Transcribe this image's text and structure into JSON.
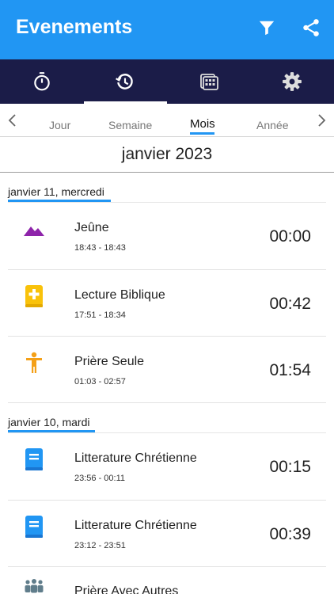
{
  "header": {
    "title": "Evenements",
    "background": "#2196f3",
    "actions": [
      {
        "icon": "filter-icon"
      },
      {
        "icon": "share-icon"
      }
    ]
  },
  "nav": {
    "background": "#1b1c48",
    "tabs": [
      {
        "icon": "stopwatch-icon",
        "active": false
      },
      {
        "icon": "history-icon",
        "active": true
      },
      {
        "icon": "calendar-grid-icon",
        "active": false
      },
      {
        "icon": "gear-icon",
        "active": false
      }
    ]
  },
  "period": {
    "tabs": [
      {
        "label": "Jour",
        "active": false
      },
      {
        "label": "Semaine",
        "active": false
      },
      {
        "label": "Mois",
        "active": true
      },
      {
        "label": "Année",
        "active": false
      }
    ]
  },
  "month_title": "janvier 2023",
  "sections": [
    {
      "date": "janvier 11, mercredi",
      "events": [
        {
          "icon": "mountain-icon",
          "color": "#8e24aa",
          "title": "Jeûne",
          "range": "18:43 - 18:43",
          "duration": "00:00"
        },
        {
          "icon": "bible-plus-icon",
          "color": "#f9c20a",
          "title": "Lecture Biblique",
          "range": "17:51 - 18:34",
          "duration": "00:42"
        },
        {
          "icon": "person-standing-icon",
          "color": "#f4a018",
          "title": "Prière Seule",
          "range": "01:03 - 02:57",
          "duration": "01:54"
        }
      ]
    },
    {
      "date": "janvier 10, mardi",
      "events": [
        {
          "icon": "book-icon",
          "color": "#2196f3",
          "title": "Litterature Chrétienne",
          "range": "23:56 - 00:11",
          "duration": "00:15"
        },
        {
          "icon": "book-icon",
          "color": "#2196f3",
          "title": "Litterature Chrétienne",
          "range": "23:12 - 23:51",
          "duration": "00:39"
        },
        {
          "icon": "group-icon",
          "color": "#607d8b",
          "title": "Prière Avec Autres",
          "range": "",
          "duration": ""
        }
      ]
    }
  ]
}
